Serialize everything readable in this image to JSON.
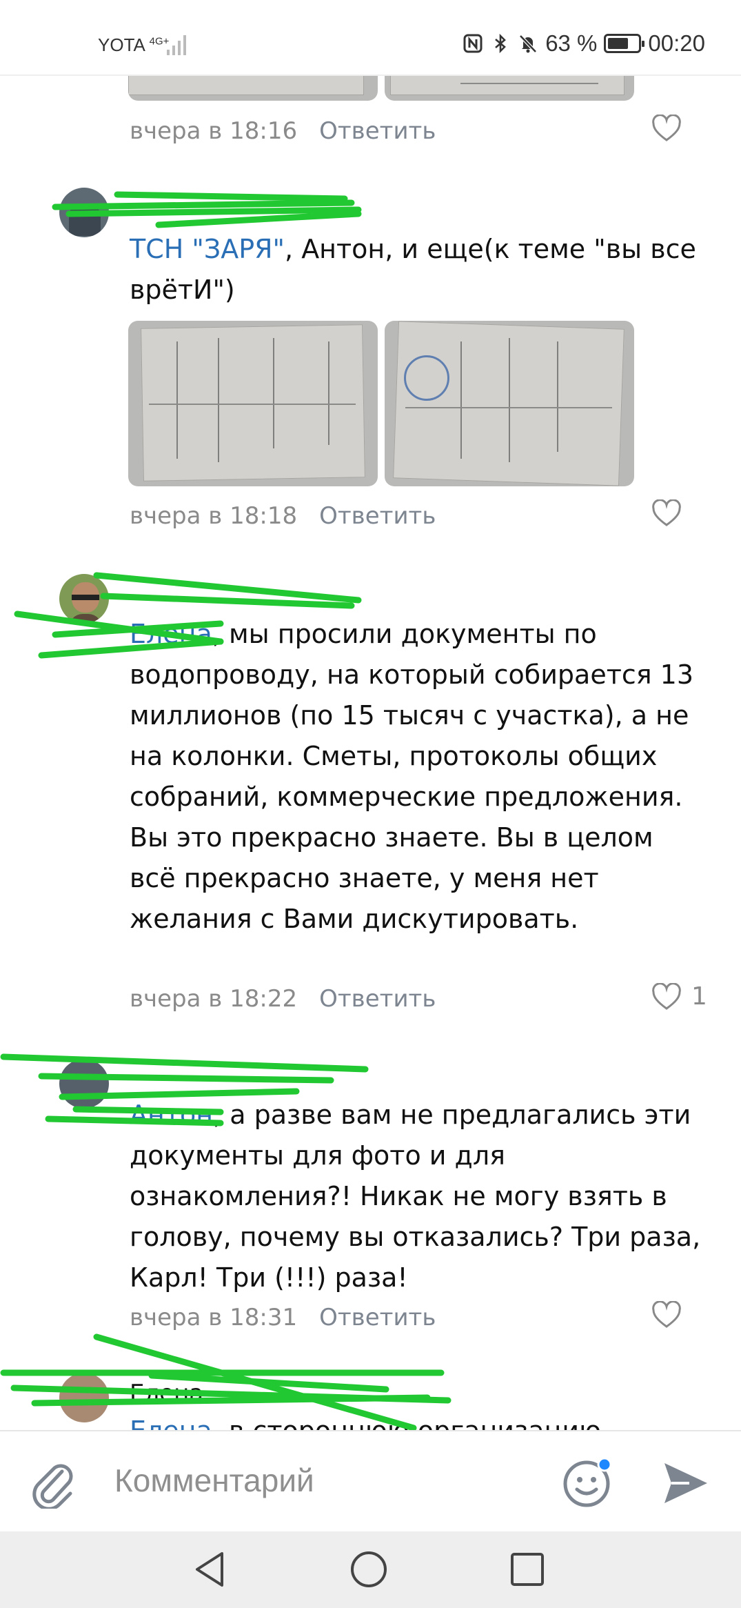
{
  "status_bar": {
    "carrier": "YOTA",
    "network": "4G+",
    "battery": "63 %",
    "time": "00:20"
  },
  "comments": [
    {
      "time": "вчера в 18:16",
      "reply": "Ответить",
      "likes": ""
    },
    {
      "mention": "ТСН \"ЗАРЯ\"",
      "text": ", Антон, и еще(к теме \"вы все врётИ\")",
      "time": "вчера в 18:18",
      "reply": "Ответить",
      "likes": ""
    },
    {
      "mention": "Елена",
      "text": ", мы просили документы по водопроводу, на который собирается 13 миллионов (по 15 тысяч с участка), а не на колонки. Сметы, протоколы общих собраний, коммерческие предложения. Вы это прекрасно знаете. Вы в целом всё прекрасно знаете, у меня нет желания с Вами дискутировать.",
      "time": "вчера в 18:22",
      "reply": "Ответить",
      "likes": "1"
    },
    {
      "mention": "Антон",
      "text": ", а разве вам не предлагались эти документы для фото и для ознакомления?! Никак не могу взять в голову, почему вы отказались? Три раза, Карл! Три (!!!) раза!",
      "time": "вчера в 18:31",
      "reply": "Ответить",
      "likes": ""
    },
    {
      "author": "Елена",
      "mention": "Елена",
      "text": ", в стороннюю организацию"
    }
  ],
  "composer": {
    "placeholder": "Комментарий"
  },
  "icons": {
    "attach": "paperclip-icon",
    "emoji": "emoji-icon",
    "send": "send-icon",
    "like": "heart-icon",
    "back": "back-triangle-icon",
    "home": "home-circle-icon",
    "recents": "recents-square-icon"
  },
  "colors": {
    "mention": "#2a6fb5",
    "meta": "#8a8a8a",
    "scribble": "#22c832",
    "emoji_dot": "#1e88ff"
  }
}
